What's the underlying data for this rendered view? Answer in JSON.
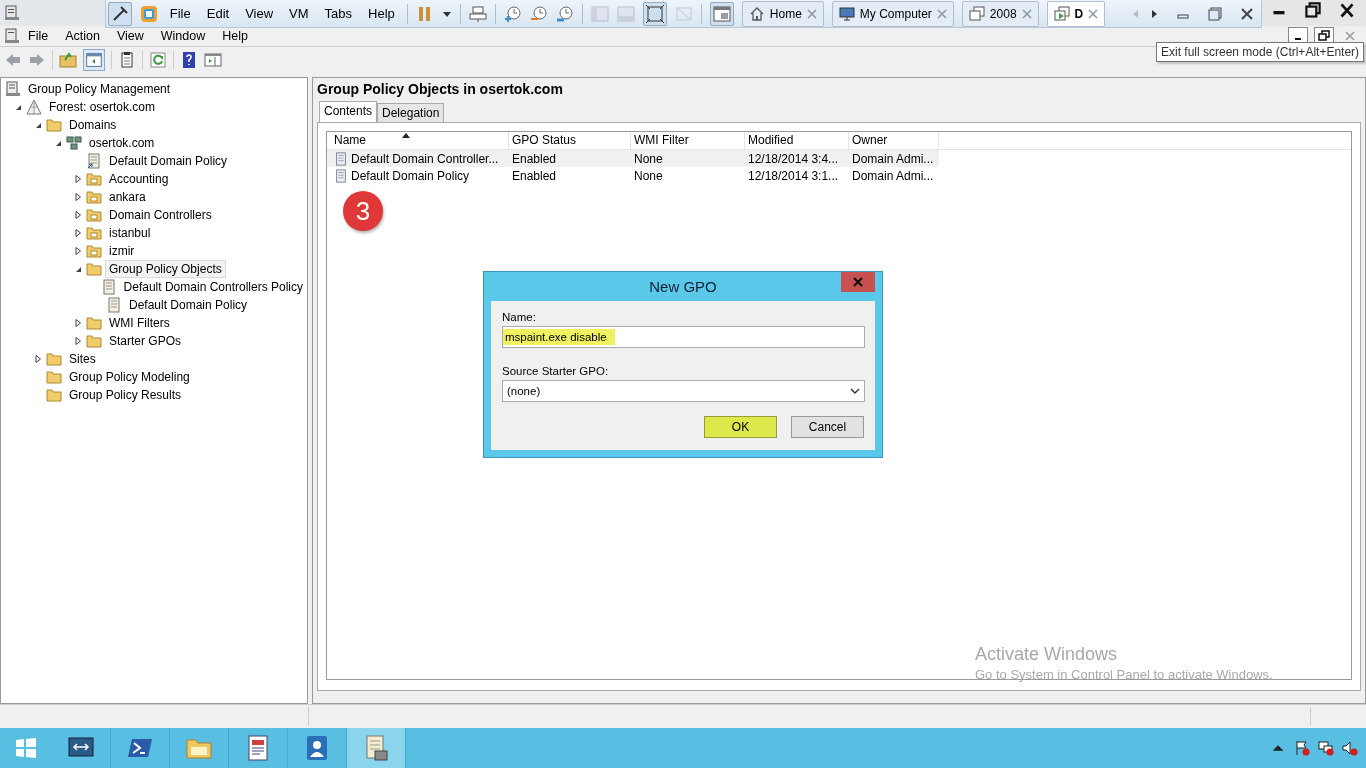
{
  "vm_toolbar": {
    "menu": [
      "File",
      "Edit",
      "View",
      "VM",
      "Tabs",
      "Help"
    ],
    "tabs": [
      {
        "label": "Home",
        "kind": "home",
        "selected": false
      },
      {
        "label": "My Computer",
        "kind": "computer",
        "selected": false
      },
      {
        "label": "2008",
        "kind": "vm",
        "selected": false
      },
      {
        "label": "D",
        "kind": "vm-running",
        "selected": true
      }
    ]
  },
  "menu_bar": [
    "File",
    "Action",
    "View",
    "Window",
    "Help"
  ],
  "tooltip": "Exit full screen mode (Ctrl+Alt+Enter)",
  "tree": [
    {
      "label": "Group Policy Management",
      "kind": "console",
      "selected": false,
      "children": [
        {
          "label": "Forest: osertok.com",
          "kind": "forest",
          "expanded": true,
          "selected": false,
          "children": [
            {
              "label": "Domains",
              "kind": "container",
              "expanded": true,
              "selected": false,
              "children": [
                {
                  "label": "osertok.com",
                  "kind": "domain",
                  "expanded": true,
                  "selected": false,
                  "children": [
                    {
                      "label": "Default Domain Policy",
                      "kind": "link",
                      "selected": false
                    },
                    {
                      "label": "Accounting",
                      "kind": "ou",
                      "expanded": false,
                      "selected": false
                    },
                    {
                      "label": "ankara",
                      "kind": "ou",
                      "expanded": false,
                      "selected": false
                    },
                    {
                      "label": "Domain Controllers",
                      "kind": "ou",
                      "expanded": false,
                      "selected": false
                    },
                    {
                      "label": "istanbul",
                      "kind": "ou",
                      "expanded": false,
                      "selected": false
                    },
                    {
                      "label": "izmir",
                      "kind": "ou",
                      "expanded": false,
                      "selected": false
                    },
                    {
                      "label": "Group Policy Objects",
                      "kind": "container",
                      "expanded": true,
                      "selected": true,
                      "children": [
                        {
                          "label": "Default Domain Controllers Policy",
                          "kind": "gpo",
                          "selected": false
                        },
                        {
                          "label": "Default Domain Policy",
                          "kind": "gpo",
                          "selected": false
                        }
                      ]
                    },
                    {
                      "label": "WMI Filters",
                      "kind": "container",
                      "expanded": false,
                      "selected": false
                    },
                    {
                      "label": "Starter GPOs",
                      "kind": "container",
                      "expanded": false,
                      "selected": false
                    }
                  ]
                }
              ]
            },
            {
              "label": "Sites",
              "kind": "container",
              "expanded": false,
              "selected": false
            },
            {
              "label": "Group Policy Modeling",
              "kind": "container",
              "selected": false
            },
            {
              "label": "Group Policy Results",
              "kind": "container",
              "selected": false
            }
          ]
        }
      ]
    }
  ],
  "panel": {
    "title": "Group Policy Objects in osertok.com",
    "tabs": [
      {
        "label": "Contents",
        "selected": true
      },
      {
        "label": "Delegation",
        "selected": false
      }
    ],
    "columns": [
      {
        "label": "Name",
        "sorted": true
      },
      {
        "label": "GPO Status",
        "sorted": false
      },
      {
        "label": "WMI Filter",
        "sorted": false
      },
      {
        "label": "Modified",
        "sorted": false
      },
      {
        "label": "Owner",
        "sorted": false
      }
    ],
    "rows": [
      {
        "selected": true,
        "cells": [
          "Default Domain Controller...",
          "Enabled",
          "None",
          "12/18/2014 3:4...",
          "Domain Admi..."
        ]
      },
      {
        "selected": false,
        "cells": [
          "Default Domain Policy",
          "Enabled",
          "None",
          "12/18/2014 3:1...",
          "Domain Admi..."
        ]
      }
    ]
  },
  "step_badge": "3",
  "dialog": {
    "title": "New GPO",
    "name_label": "Name:",
    "name_value": "mspaint.exe disable",
    "name_highlighted": true,
    "source_label": "Source Starter GPO:",
    "source_value": "(none)",
    "buttons": [
      {
        "label": "OK",
        "highlighted": true
      },
      {
        "label": "Cancel",
        "highlighted": false
      }
    ]
  },
  "activation": {
    "title": "Activate Windows",
    "text": "Go to System in Control Panel to activate Windows."
  },
  "taskbar": {
    "apps": [
      {
        "kind": "server-manager",
        "selected": false
      },
      {
        "kind": "powershell",
        "selected": false
      },
      {
        "kind": "explorer",
        "selected": false
      },
      {
        "kind": "document",
        "selected": false
      },
      {
        "kind": "contacts",
        "selected": false
      },
      {
        "kind": "policy",
        "selected": true
      }
    ]
  }
}
